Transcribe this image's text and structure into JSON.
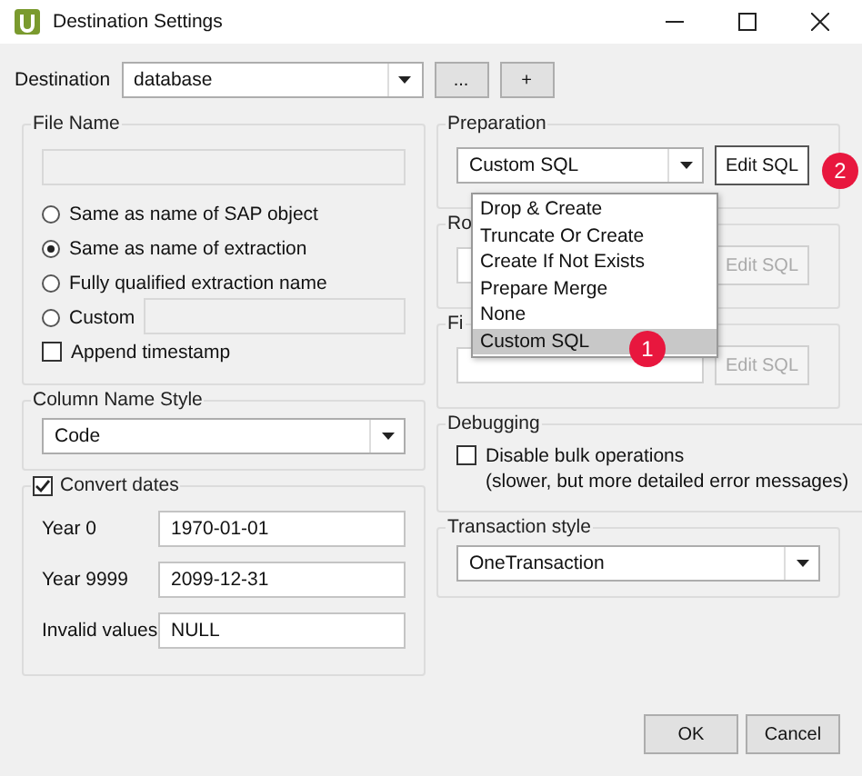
{
  "window": {
    "title": "Destination Settings"
  },
  "destination": {
    "label": "Destination",
    "value": "database",
    "buttons": [
      "...",
      "+"
    ]
  },
  "file_name": {
    "title": "File Name",
    "options": [
      {
        "label": "Same as name of SAP object",
        "selected": false,
        "kind": "plain"
      },
      {
        "label": "Same as name of extraction",
        "selected": true,
        "kind": "plain"
      },
      {
        "label": "Fully qualified extraction name",
        "selected": false,
        "kind": "plain"
      },
      {
        "label": "Custom",
        "selected": false,
        "kind": "custom"
      }
    ],
    "append_timestamp": {
      "label": "Append timestamp",
      "checked": false
    }
  },
  "column_name_style": {
    "title": "Column Name Style",
    "value": "Code"
  },
  "convert_dates": {
    "label": "Convert dates",
    "checked": true,
    "fields": [
      {
        "label": "Year 0",
        "value": "1970-01-01"
      },
      {
        "label": "Year 9999",
        "value": "2099-12-31"
      },
      {
        "label": "Invalid values",
        "value": "NULL"
      }
    ]
  },
  "preparation": {
    "title": "Preparation",
    "value": "Custom SQL",
    "button": "Edit SQL",
    "badge": "2"
  },
  "covered_groups": [
    {
      "title": "Ro",
      "button": "Edit SQL",
      "disabled": true
    },
    {
      "title": "Fi",
      "button": "Edit SQL",
      "disabled": true
    }
  ],
  "dropdown_list": {
    "badge": "1",
    "items": [
      {
        "label": "Drop & Create",
        "selected": false
      },
      {
        "label": "Truncate Or Create",
        "selected": false
      },
      {
        "label": "Create If Not Exists",
        "selected": false
      },
      {
        "label": "Prepare Merge",
        "selected": false
      },
      {
        "label": "None",
        "selected": false
      },
      {
        "label": "Custom SQL",
        "selected": true
      }
    ]
  },
  "debugging": {
    "title": "Debugging",
    "option": {
      "label": "Disable bulk operations",
      "checked": false
    },
    "note": "(slower, but more detailed error messages)"
  },
  "transaction_style": {
    "title": "Transaction style",
    "value": "OneTransaction"
  },
  "buttons": [
    "OK",
    "Cancel"
  ]
}
